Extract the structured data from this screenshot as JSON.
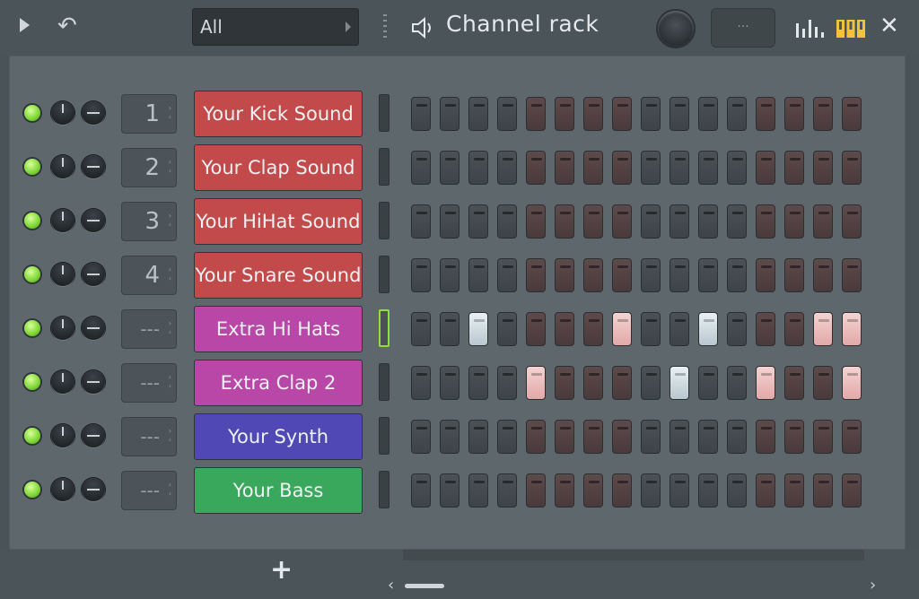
{
  "toolbar": {
    "filter_value": "All",
    "title": "Channel rack",
    "display_value": "···",
    "close_glyph": "✕",
    "undo_glyph": "↶"
  },
  "channels": [
    {
      "track": "1",
      "name": "Your Kick Sound",
      "color": "#c24a4a"
    },
    {
      "track": "2",
      "name": "Your Clap Sound",
      "color": "#c24a4a"
    },
    {
      "track": "3",
      "name": "Your HiHat Sound",
      "color": "#c24a4a"
    },
    {
      "track": "4",
      "name": "Your Snare Sound",
      "color": "#c24a4a"
    },
    {
      "track": "---",
      "name": "Extra Hi Hats",
      "color": "#b847a8"
    },
    {
      "track": "---",
      "name": "Extra Clap 2",
      "color": "#b847a8"
    },
    {
      "track": "---",
      "name": "Your Synth",
      "color": "#5049b5"
    },
    {
      "track": "---",
      "name": "Your Bass",
      "color": "#3aa85c"
    }
  ],
  "steps": {
    "on_white": [
      [],
      [],
      [],
      [],
      [
        2,
        10
      ],
      [
        9
      ],
      [],
      []
    ],
    "on_pink": [
      [],
      [],
      [],
      [],
      [
        7,
        14,
        15
      ],
      [
        4,
        12,
        15
      ],
      [],
      []
    ],
    "selected_row": 4
  },
  "bottom": {
    "add_glyph": "+",
    "left_arrow": "‹",
    "right_arrow": "›"
  }
}
